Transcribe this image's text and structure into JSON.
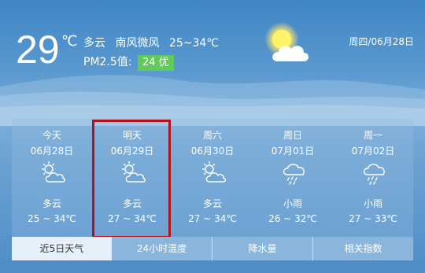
{
  "current": {
    "temperature": "29",
    "unit": "℃",
    "condition": "多云",
    "wind": "南风微风",
    "range": "25~34℃",
    "pm25_label": "PM2.5值:",
    "aqi_value": "24",
    "aqi_level": "优",
    "date": "周四/06月28日"
  },
  "forecast": [
    {
      "name": "今天",
      "date": "06月28日",
      "icon": "partly-cloudy-icon",
      "condition": "多云",
      "range": "25 ~ 34℃"
    },
    {
      "name": "明天",
      "date": "06月29日",
      "icon": "partly-cloudy-icon",
      "condition": "多云",
      "range": "27 ~ 34℃"
    },
    {
      "name": "周六",
      "date": "06月30日",
      "icon": "partly-cloudy-icon",
      "condition": "多云",
      "range": "27 ~ 34℃"
    },
    {
      "name": "周日",
      "date": "07月01日",
      "icon": "light-rain-icon",
      "condition": "小雨",
      "range": "26 ~ 32℃"
    },
    {
      "name": "周一",
      "date": "07月02日",
      "icon": "light-rain-icon",
      "condition": "小雨",
      "range": "27 ~ 33℃"
    }
  ],
  "tabs": [
    {
      "label": "近5日天气",
      "active": true
    },
    {
      "label": "24小时温度",
      "active": false
    },
    {
      "label": "降水量",
      "active": false
    },
    {
      "label": "相关指数",
      "active": false
    }
  ],
  "colors": {
    "aqi_good": "#5fcb5a",
    "selected_outline": "#b0141a"
  }
}
